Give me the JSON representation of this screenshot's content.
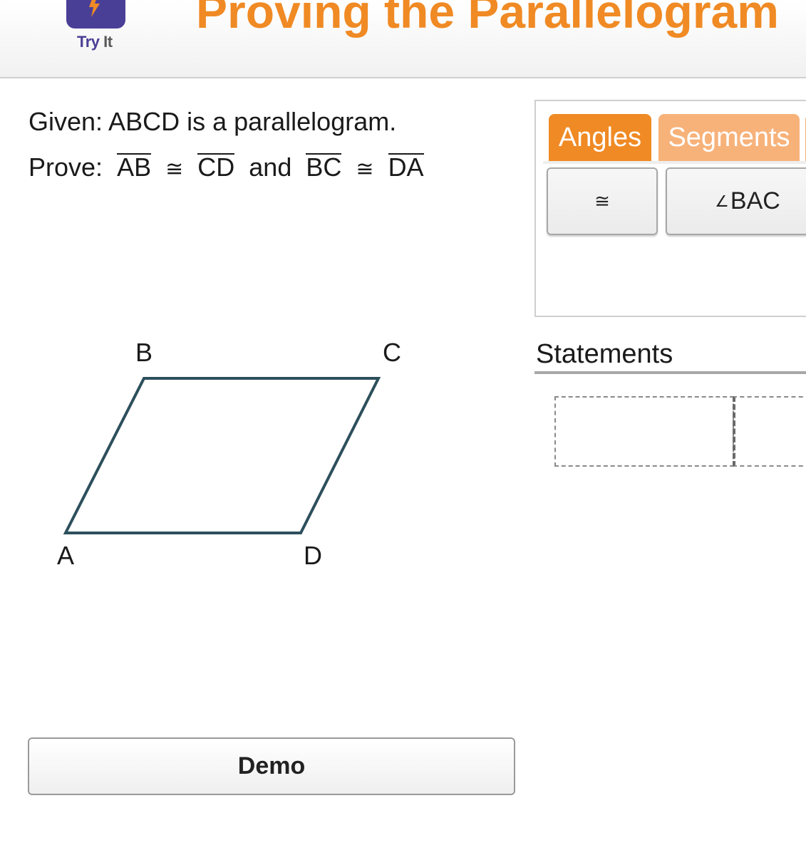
{
  "header": {
    "app_label_try": "Try",
    "app_label_it": "It",
    "app_icon": "lightning-bolt-icon",
    "title": "Proving the Parallelogram"
  },
  "problem": {
    "given": "Given: ABCD is a parallelogram.",
    "prove_label": "Prove:",
    "seg1": "AB",
    "cong1": "≅",
    "seg2": "CD",
    "and": "and",
    "seg3": "BC",
    "cong2": "≅",
    "seg4": "DA"
  },
  "figure": {
    "label_a": "A",
    "label_b": "B",
    "label_c": "C",
    "label_d": "D",
    "stroke_color": "#2d4f5c"
  },
  "demo_button": {
    "label": "Demo"
  },
  "palette": {
    "tabs": [
      {
        "label": "Angles",
        "active": true
      },
      {
        "label": "Segments",
        "active": false
      },
      {
        "label": "",
        "active": false
      }
    ],
    "symbols": [
      {
        "label": "≅"
      },
      {
        "angle_symbol": "∠",
        "label": "BAC"
      }
    ]
  },
  "statements": {
    "label": "Statements"
  },
  "colors": {
    "accent": "#f08a24",
    "tab_inactive": "#f7b27a",
    "icon_bg": "#4a3f96"
  }
}
